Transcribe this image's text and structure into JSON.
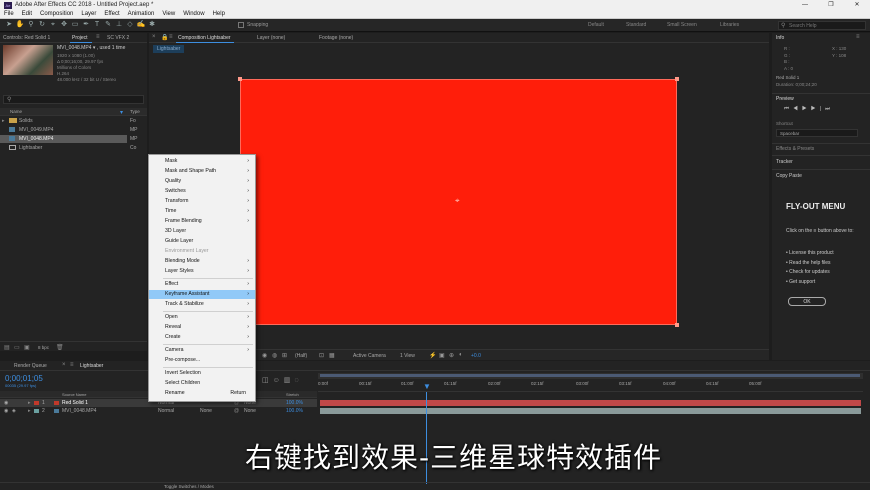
{
  "window": {
    "title": "Adobe After Effects CC 2018 - Untitled Project.aep *",
    "controls": [
      "—",
      "❐",
      "✕"
    ]
  },
  "menubar": [
    "File",
    "Edit",
    "Composition",
    "Layer",
    "Effect",
    "Animation",
    "View",
    "Window",
    "Help"
  ],
  "toolbar": {
    "snapping": "Snapping",
    "workspaces": [
      "Default",
      "Standard",
      "Small Screen",
      "Libraries"
    ],
    "search_placeholder": "Search Help"
  },
  "effect_controls_tab": "Controls: Red Solid 1",
  "project": {
    "tab": "Project",
    "tab2": "SC VFX 2",
    "selected_name": "MVI_0048.MP4 ▾ , used 1 time",
    "info": [
      "1920 x 1080 (1.00)",
      "Δ 0;00;16;00, 29.97 fps",
      "Millions of Colors",
      "H.264",
      "48.000 kHz / 32 bit U / Stereo"
    ],
    "columns": {
      "name": "Name",
      "type": "Type"
    },
    "items": [
      {
        "name": "Solids",
        "type": "Fo"
      },
      {
        "name": "MVI_0049.MP4",
        "type": "MP"
      },
      {
        "name": "MVI_0048.MP4",
        "type": "MP"
      },
      {
        "name": "Lightsaber",
        "type": "Co"
      }
    ],
    "bpc": "8 bpc"
  },
  "composition": {
    "tab": "Composition Lightsaber",
    "layer_tab": "Layer (none)",
    "footage_tab": "Footage (none)",
    "crumb": "Lightsaber",
    "footer": {
      "res": "(Half)",
      "camera": "Active Camera",
      "views": "1 View",
      "exposure": "+0.0"
    }
  },
  "context_menu": [
    {
      "label": "Mask",
      "arrow": true
    },
    {
      "label": "Mask and Shape Path",
      "arrow": true
    },
    {
      "label": "Quality",
      "arrow": true
    },
    {
      "label": "Switches",
      "arrow": true
    },
    {
      "label": "Transform",
      "arrow": true
    },
    {
      "label": "Time",
      "arrow": true
    },
    {
      "label": "Frame Blending",
      "arrow": true
    },
    {
      "label": "3D Layer",
      "arrow": false
    },
    {
      "label": "Guide Layer",
      "arrow": false
    },
    {
      "label": "Environment Layer",
      "arrow": false,
      "disabled": true
    },
    {
      "label": "Blending Mode",
      "arrow": true
    },
    {
      "label": "Layer Styles",
      "arrow": true
    },
    {
      "label": "Effect",
      "arrow": true,
      "sep_before": true
    },
    {
      "label": "Keyframe Assistant",
      "arrow": true,
      "highlighted": true
    },
    {
      "label": "Track & Stabilize",
      "arrow": true
    },
    {
      "label": "Open",
      "arrow": true,
      "sep_before": true
    },
    {
      "label": "Reveal",
      "arrow": true
    },
    {
      "label": "Create",
      "arrow": true
    },
    {
      "label": "Camera",
      "arrow": true,
      "sep_before": true
    },
    {
      "label": "Pre-compose...",
      "arrow": false
    },
    {
      "label": "Invert Selection",
      "arrow": false,
      "sep_before": true
    },
    {
      "label": "Select Children",
      "arrow": false
    },
    {
      "label": "Rename",
      "arrow": false,
      "shortcut": "Return"
    }
  ],
  "right": {
    "info_tab": "Info",
    "info_vals": [
      "R :",
      "G :",
      "B :",
      "A : 0",
      "X : 130",
      "Y : 108"
    ],
    "info_layer": "Red Solid 1",
    "info_dur": "Duration: 0;00;24;20",
    "preview_tab": "Preview",
    "shortcut_label": "Shortcut",
    "shortcut_val": "Spacebar",
    "effects_tab": "Effects & Presets",
    "tracker_tab": "Tracker",
    "copy_tab": "Copy Paste",
    "flyout_title": "FLY-OUT MENU",
    "flyout_desc": "Click on the ≡ button above to:",
    "flyout_items": [
      "License this product",
      "Read the help files",
      "Check for updates",
      "Get support"
    ],
    "ok": "OK"
  },
  "timeline": {
    "render_tab": "Render Queue",
    "comp_tab": "Lightsaber",
    "timecode": "0;00;01;05",
    "timecode_sub": "00035 (29.97 fps)",
    "cols": {
      "name": "Source Name",
      "mode": "Mode",
      "parent": "Parent",
      "stretch": "Stretch"
    },
    "ruler": [
      "0:00f",
      "00:15f",
      "01:00f",
      "01:15f",
      "02:00f",
      "02:15f",
      "03:00f",
      "03:15f",
      "04:00f",
      "04:15f",
      "05:00f"
    ],
    "layers": [
      {
        "num": "1",
        "name": "Red Solid 1",
        "mode": "Normal",
        "trk": "",
        "parent": "None",
        "stretch": "100.0%",
        "color": "#c0392b",
        "sel": true
      },
      {
        "num": "2",
        "name": "MVI_0048.MP4",
        "mode": "Normal",
        "trk": "None",
        "parent": "None",
        "stretch": "100.0%",
        "color": "#6aa0a0",
        "sel": false
      }
    ],
    "toggle": "Toggle Switches / Modes"
  },
  "subtitle": "右键找到效果-三维星球特效插件",
  "colors": {
    "solid": "#ff1e0a",
    "accent": "#3d8ee0",
    "menu_hl": "#91c9f7"
  }
}
